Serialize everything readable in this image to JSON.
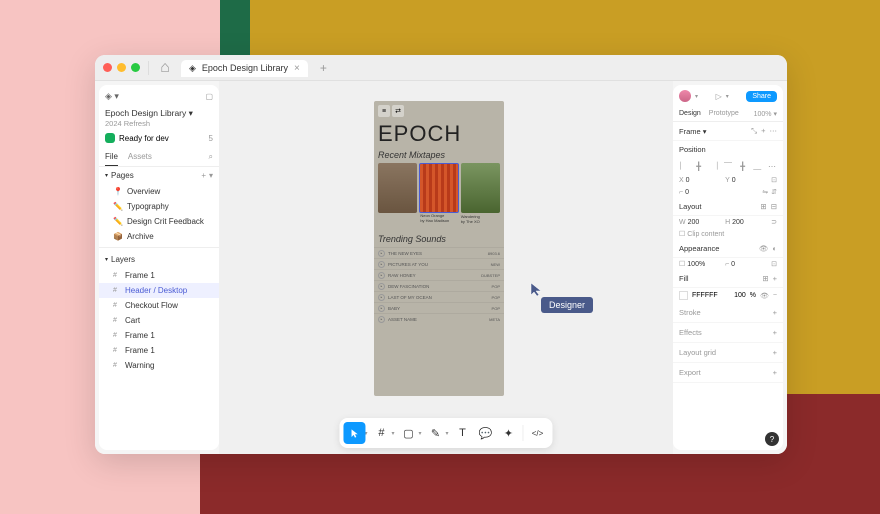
{
  "tab": {
    "title": "Epoch Design Library"
  },
  "sidebar": {
    "title": "Epoch Design Library",
    "subtitle": "2024 Refresh",
    "status": {
      "label": "Ready for dev",
      "count": "5"
    },
    "tabs": {
      "file": "File",
      "assets": "Assets"
    },
    "pages_label": "Pages",
    "pages": [
      {
        "icon": "📍",
        "label": "Overview"
      },
      {
        "icon": "✏️",
        "label": "Typography"
      },
      {
        "icon": "✏️",
        "label": "Design Crit Feedback"
      },
      {
        "icon": "📦",
        "label": "Archive"
      }
    ],
    "layers_label": "Layers",
    "layers": [
      {
        "label": "Frame 1",
        "sel": false
      },
      {
        "label": "Header / Desktop",
        "sel": true
      },
      {
        "label": "Checkout Flow",
        "sel": false
      },
      {
        "label": "Cart",
        "sel": false
      },
      {
        "label": "Frame 1",
        "sel": false
      },
      {
        "label": "Frame 1",
        "sel": false
      },
      {
        "label": "Warning",
        "sel": false
      }
    ]
  },
  "artboard": {
    "logo": "EPOCH",
    "recent": "Recent Mixtapes",
    "trending": "Trending Sounds",
    "mixtapes": [
      {
        "title": "",
        "by": ""
      },
      {
        "title": "Neon Orange",
        "by": "by Hao Madison"
      },
      {
        "title": "Wandering",
        "by": "by The XO"
      }
    ],
    "tracks": [
      {
        "name": "THE NEW EYES",
        "tag": "8903.6"
      },
      {
        "name": "PICTURES AT YOU",
        "tag": "NEW"
      },
      {
        "name": "RAW HONEY",
        "tag": "DUBSTEP"
      },
      {
        "name": "DEW FASCINATION",
        "tag": "POP"
      },
      {
        "name": "LAST OF MY OCEAN",
        "tag": "POP"
      },
      {
        "name": "BABY",
        "tag": "POP"
      },
      {
        "name": "ASSET NAME",
        "tag": "META"
      }
    ]
  },
  "cursor_label": "Designer",
  "rpanel": {
    "share": "Share",
    "tabs": {
      "design": "Design",
      "prototype": "Prototype",
      "zoom": "100%"
    },
    "frame": "Frame",
    "position": "Position",
    "pos": {
      "x": "0",
      "y": "0",
      "l": "0"
    },
    "layout": "Layout",
    "dims": {
      "w": "200",
      "h": "200"
    },
    "clip": "Clip content",
    "appearance": "Appearance",
    "opacity": "100%",
    "radius": "0",
    "fill_label": "Fill",
    "fill": {
      "hex": "FFFFFF",
      "alpha": "100",
      "pct": "%"
    },
    "sections": [
      "Stroke",
      "Effects",
      "Layout grid",
      "Export"
    ]
  }
}
